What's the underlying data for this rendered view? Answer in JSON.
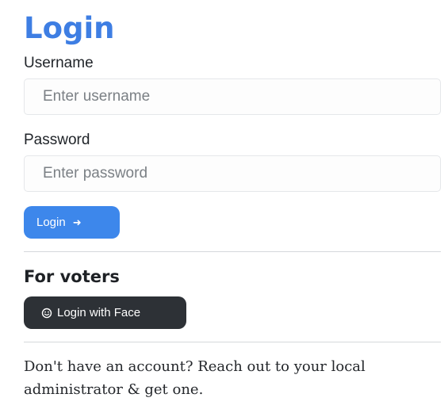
{
  "login": {
    "title": "Login",
    "username": {
      "label": "Username",
      "placeholder": "Enter username",
      "value": ""
    },
    "password": {
      "label": "Password",
      "placeholder": "Enter password",
      "value": ""
    },
    "submit_label": "Login",
    "submit_icon": "arrow-right-icon"
  },
  "voters": {
    "title": "For voters",
    "face_button_label": "Login with Face",
    "face_button_icon": "face-icon"
  },
  "footer": {
    "text": "Don't have an account? Reach out to your local administrator & get one."
  },
  "colors": {
    "title": "#3e7ee3",
    "primary_button": "#3d87eb",
    "dark_button": "#2d3136",
    "divider": "#d5d8db"
  }
}
